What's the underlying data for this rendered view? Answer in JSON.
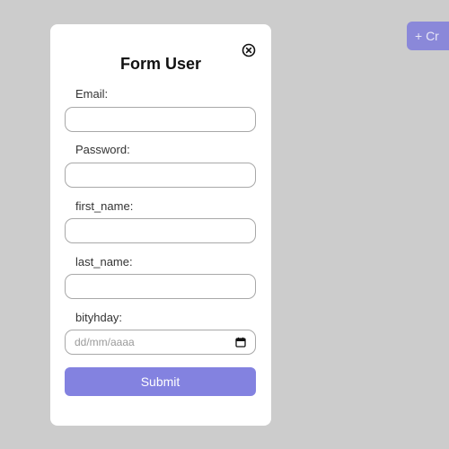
{
  "page": {
    "create_button_label": "+ Cr"
  },
  "form": {
    "title": "Form User",
    "close_icon": "close-circle-icon",
    "fields": [
      {
        "label": "Email:",
        "value": ""
      },
      {
        "label": "Password:",
        "value": ""
      },
      {
        "label": "first_name:",
        "value": ""
      },
      {
        "label": "last_name:",
        "value": ""
      },
      {
        "label": "bityhday:",
        "placeholder": "dd/mm/aaaa",
        "icon": "calendar-icon"
      }
    ],
    "submit_label": "Submit"
  },
  "colors": {
    "background": "#cccccc",
    "accent": "#8382e0",
    "modal": "#ffffff"
  }
}
